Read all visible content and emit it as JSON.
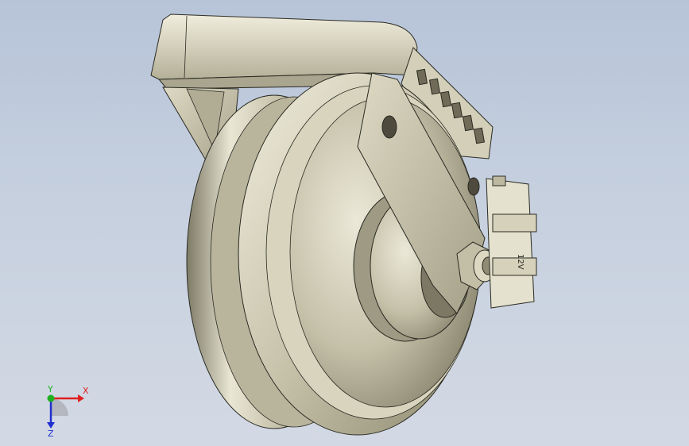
{
  "viewport": {
    "background_top": "#b7c4d8",
    "background_bottom": "#d3d9e4"
  },
  "model": {
    "part_marking": "12V",
    "metal_color": "#c9c5ad",
    "shadow_color": "#6f6b58",
    "edge_color": "#2a2a22"
  },
  "triad": {
    "x_label": "X",
    "y_label": "Y",
    "z_label": "Z",
    "x_color": "#e02020",
    "y_color": "#20b020",
    "z_color": "#2030d0"
  }
}
